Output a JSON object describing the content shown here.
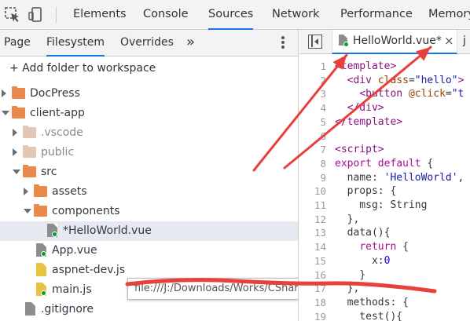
{
  "toolbar": {
    "icons": [
      "inspect-element-icon",
      "device-toolbar-icon"
    ],
    "tabs": [
      {
        "label": "Elements",
        "active": false
      },
      {
        "label": "Console",
        "active": false
      },
      {
        "label": "Sources",
        "active": true
      },
      {
        "label": "Network",
        "active": false
      },
      {
        "label": "Performance",
        "active": false
      },
      {
        "label": "Memory",
        "active": false
      }
    ]
  },
  "navigator": {
    "tabs": [
      {
        "label": "Page",
        "active": false
      },
      {
        "label": "Filesystem",
        "active": true
      },
      {
        "label": "Overrides",
        "active": false
      }
    ],
    "more_label": "»",
    "add_folder_label": "+ Add folder to workspace",
    "tree": [
      {
        "label": "DocPress",
        "type": "folder",
        "expanded": false
      },
      {
        "label": "client-app",
        "type": "folder",
        "expanded": true
      },
      {
        "label": ".vscode",
        "type": "folder",
        "expanded": false,
        "dim": true
      },
      {
        "label": "public",
        "type": "folder",
        "expanded": false,
        "dim": true
      },
      {
        "label": "src",
        "type": "folder",
        "expanded": true
      },
      {
        "label": "assets",
        "type": "folder",
        "expanded": false
      },
      {
        "label": "components",
        "type": "folder",
        "expanded": true
      },
      {
        "label": "*HelloWorld.vue",
        "type": "file",
        "selected": true,
        "mapped": true
      },
      {
        "label": "App.vue",
        "type": "file",
        "mapped": true
      },
      {
        "label": "aspnet-dev.js",
        "type": "file-js"
      },
      {
        "label": "main.js",
        "type": "file-js",
        "mapped": true
      },
      {
        "label": ".gitignore",
        "type": "file"
      }
    ],
    "tooltip": "file:///J:/Downloads/Works/CSharp/Project-My/DocPress/DocPress/client-app/src/components/HelloWorld.vue"
  },
  "editor": {
    "tab_label": "HelloWorld.vue*",
    "close_label": "×",
    "more_tab_label": "j",
    "lines": [
      {
        "n": "1",
        "parts": [
          [
            "tag",
            "<template>"
          ]
        ]
      },
      {
        "n": "2",
        "parts": [
          [
            "pl",
            "  "
          ],
          [
            "tag",
            "<div "
          ],
          [
            "attr",
            "class"
          ],
          [
            "pl",
            "="
          ],
          [
            "str",
            "\"hello\""
          ],
          [
            "tag",
            ">"
          ]
        ]
      },
      {
        "n": "3",
        "parts": [
          [
            "pl",
            "    "
          ],
          [
            "tag",
            "<button "
          ],
          [
            "attr",
            "@click"
          ],
          [
            "pl",
            "="
          ],
          [
            "str",
            "\"t"
          ]
        ]
      },
      {
        "n": "4",
        "parts": [
          [
            "pl",
            "  "
          ],
          [
            "tag",
            "</div>"
          ]
        ]
      },
      {
        "n": "5",
        "parts": [
          [
            "tag",
            "</template>"
          ]
        ]
      },
      {
        "n": "6",
        "parts": []
      },
      {
        "n": "7",
        "parts": [
          [
            "tag",
            "<script>"
          ]
        ]
      },
      {
        "n": "8",
        "parts": [
          [
            "kw",
            "export default "
          ],
          [
            "pl",
            "{"
          ]
        ]
      },
      {
        "n": "9",
        "parts": [
          [
            "pl",
            "  name: "
          ],
          [
            "str",
            "'HelloWorld'"
          ],
          [
            "pl",
            ","
          ]
        ]
      },
      {
        "n": "10",
        "parts": [
          [
            "pl",
            "  props: {"
          ]
        ]
      },
      {
        "n": "11",
        "parts": [
          [
            "pl",
            "    msg: String"
          ]
        ]
      },
      {
        "n": "12",
        "parts": [
          [
            "pl",
            "  },"
          ]
        ]
      },
      {
        "n": "13",
        "parts": [
          [
            "pl",
            "  data(){"
          ]
        ]
      },
      {
        "n": "14",
        "parts": [
          [
            "pl",
            "    "
          ],
          [
            "kw",
            "return "
          ],
          [
            "pl",
            "{"
          ]
        ]
      },
      {
        "n": "15",
        "parts": [
          [
            "pl",
            "      x:"
          ],
          [
            "num",
            "0"
          ]
        ]
      },
      {
        "n": "16",
        "parts": [
          [
            "pl",
            "    }"
          ]
        ]
      },
      {
        "n": "17",
        "parts": [
          [
            "pl",
            "  },"
          ]
        ]
      },
      {
        "n": "18",
        "parts": [
          [
            "pl",
            "  methods: {"
          ]
        ]
      },
      {
        "n": "19",
        "parts": [
          [
            "pl",
            "    test(){"
          ]
        ]
      }
    ]
  },
  "annotations": {
    "arrow_color": "#e8403a",
    "dot_color": "#0b9e2a",
    "accent_color": "#1a73e8"
  }
}
